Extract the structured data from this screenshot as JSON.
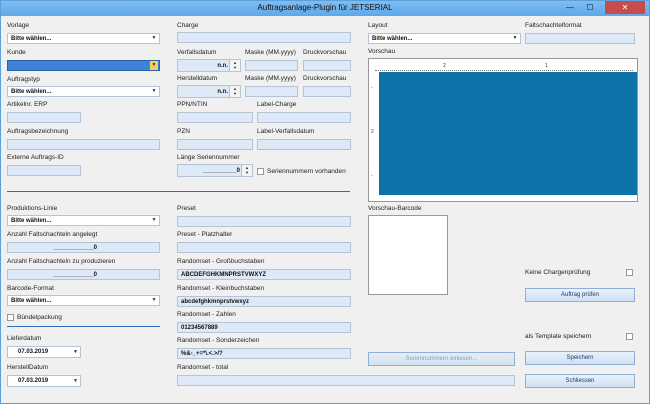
{
  "window": {
    "title": "Auftragsanlage-Plugin für JETSERIAL",
    "min": "—",
    "max": "☐",
    "close": "✕"
  },
  "col1": {
    "vorlage_label": "Vorlage",
    "vorlage_value": "Bitte wählen...",
    "kunde_label": "Kunde",
    "kunde_value": "",
    "auftragstyp_label": "Auftragstyp",
    "auftragstyp_value": "Bitte wählen...",
    "artikelnr_label": "Artikelnr. ERP",
    "auftragsbez_label": "Auftragsbezeichnung",
    "extern_label": "Externe Auftrags-ID",
    "produktionslinie_label": "Produktions-Linie",
    "produktionslinie_value": "Bitte wählen...",
    "anzahl_angelegt_label": "Anzahl Faltschachteln angelegt",
    "anzahl_angelegt_value": "____________0",
    "anzahl_zu_label": "Anzahl Faltschachteln zu produzieren",
    "anzahl_zu_value": "____________0",
    "barcode_format_label": "Barcode-Format",
    "barcode_format_value": "Bitte wählen...",
    "buendel_label": "Bündelpackung",
    "lieferdatum_label": "Lieferdatum",
    "lieferdatum_value": "07.03.2019",
    "herstelldatum_label": "HerstellDatum",
    "herstelldatum_value": "07.03.2019"
  },
  "col2": {
    "charge_label": "Charge",
    "verfall_label": "Verfallsdatum",
    "verfall_value": "n.n.",
    "maske1_label": "Maske (MM.yyyy)",
    "druck1_label": "Druckvorschau",
    "herstell_label": "Herstelldatum",
    "herstell_value": "n.n.",
    "maske2_label": "Maske (MM.yyyy)",
    "druck2_label": "Druckvorschau",
    "ppn_label": "PPN/NTIN",
    "labelcharge_label": "Label-Charge",
    "pzn_label": "PZN",
    "labelverfall_label": "Label-Verfallsdatum",
    "laenge_label": "Länge Seriennummer",
    "laenge_value": "__________0",
    "seriennr_vorhanden_label": "Seriennummern vorhanden",
    "preset_label": "Preset",
    "platzhalter_label": "Preset - Platzhalter",
    "gross_label": "Randomset - Großbuchstaben",
    "gross_value": "ABCDEFGHKMNPRSTVWXYZ",
    "klein_label": "Randomset - Kleinbuchstaben",
    "klein_value": "abcdefghkmnprstvwxyz",
    "zahlen_label": "Randomset - Zahlen",
    "zahlen_value": "01234567889",
    "sonder_label": "Randomset - Sonderzeichen",
    "sonder_value": "%&-_+=*\\.<.>/?",
    "total_label": "Randomset - total"
  },
  "col3": {
    "layout_label": "Layout",
    "layout_value": "Bitte wählen...",
    "vorschau_label": "Vorschau",
    "ruler_marks": [
      "2",
      "1"
    ],
    "ruler_v_marks": [
      "-",
      "2",
      "-"
    ],
    "barcode_label": "Vorschau-Barcode",
    "seriennr_einlesen_button": "Seriennummern einlesen..."
  },
  "col4": {
    "faltschachtel_label": "Faltschachtelformat",
    "keine_charge_label": "Keine Chargenprüfung",
    "auftrag_pruefen_button": "Auftrag prüfen",
    "template_label": "als Template speichern",
    "speichern_button": "Speichern",
    "schliessen_button": "Schliessen"
  },
  "icons": {
    "dropdown": "▼",
    "spin_up": "▲",
    "spin_down": "▼"
  },
  "colors": {
    "preview_canvas": "#0c72a7",
    "divider": "#2c6fb6",
    "active_input": "#3c82d8"
  }
}
